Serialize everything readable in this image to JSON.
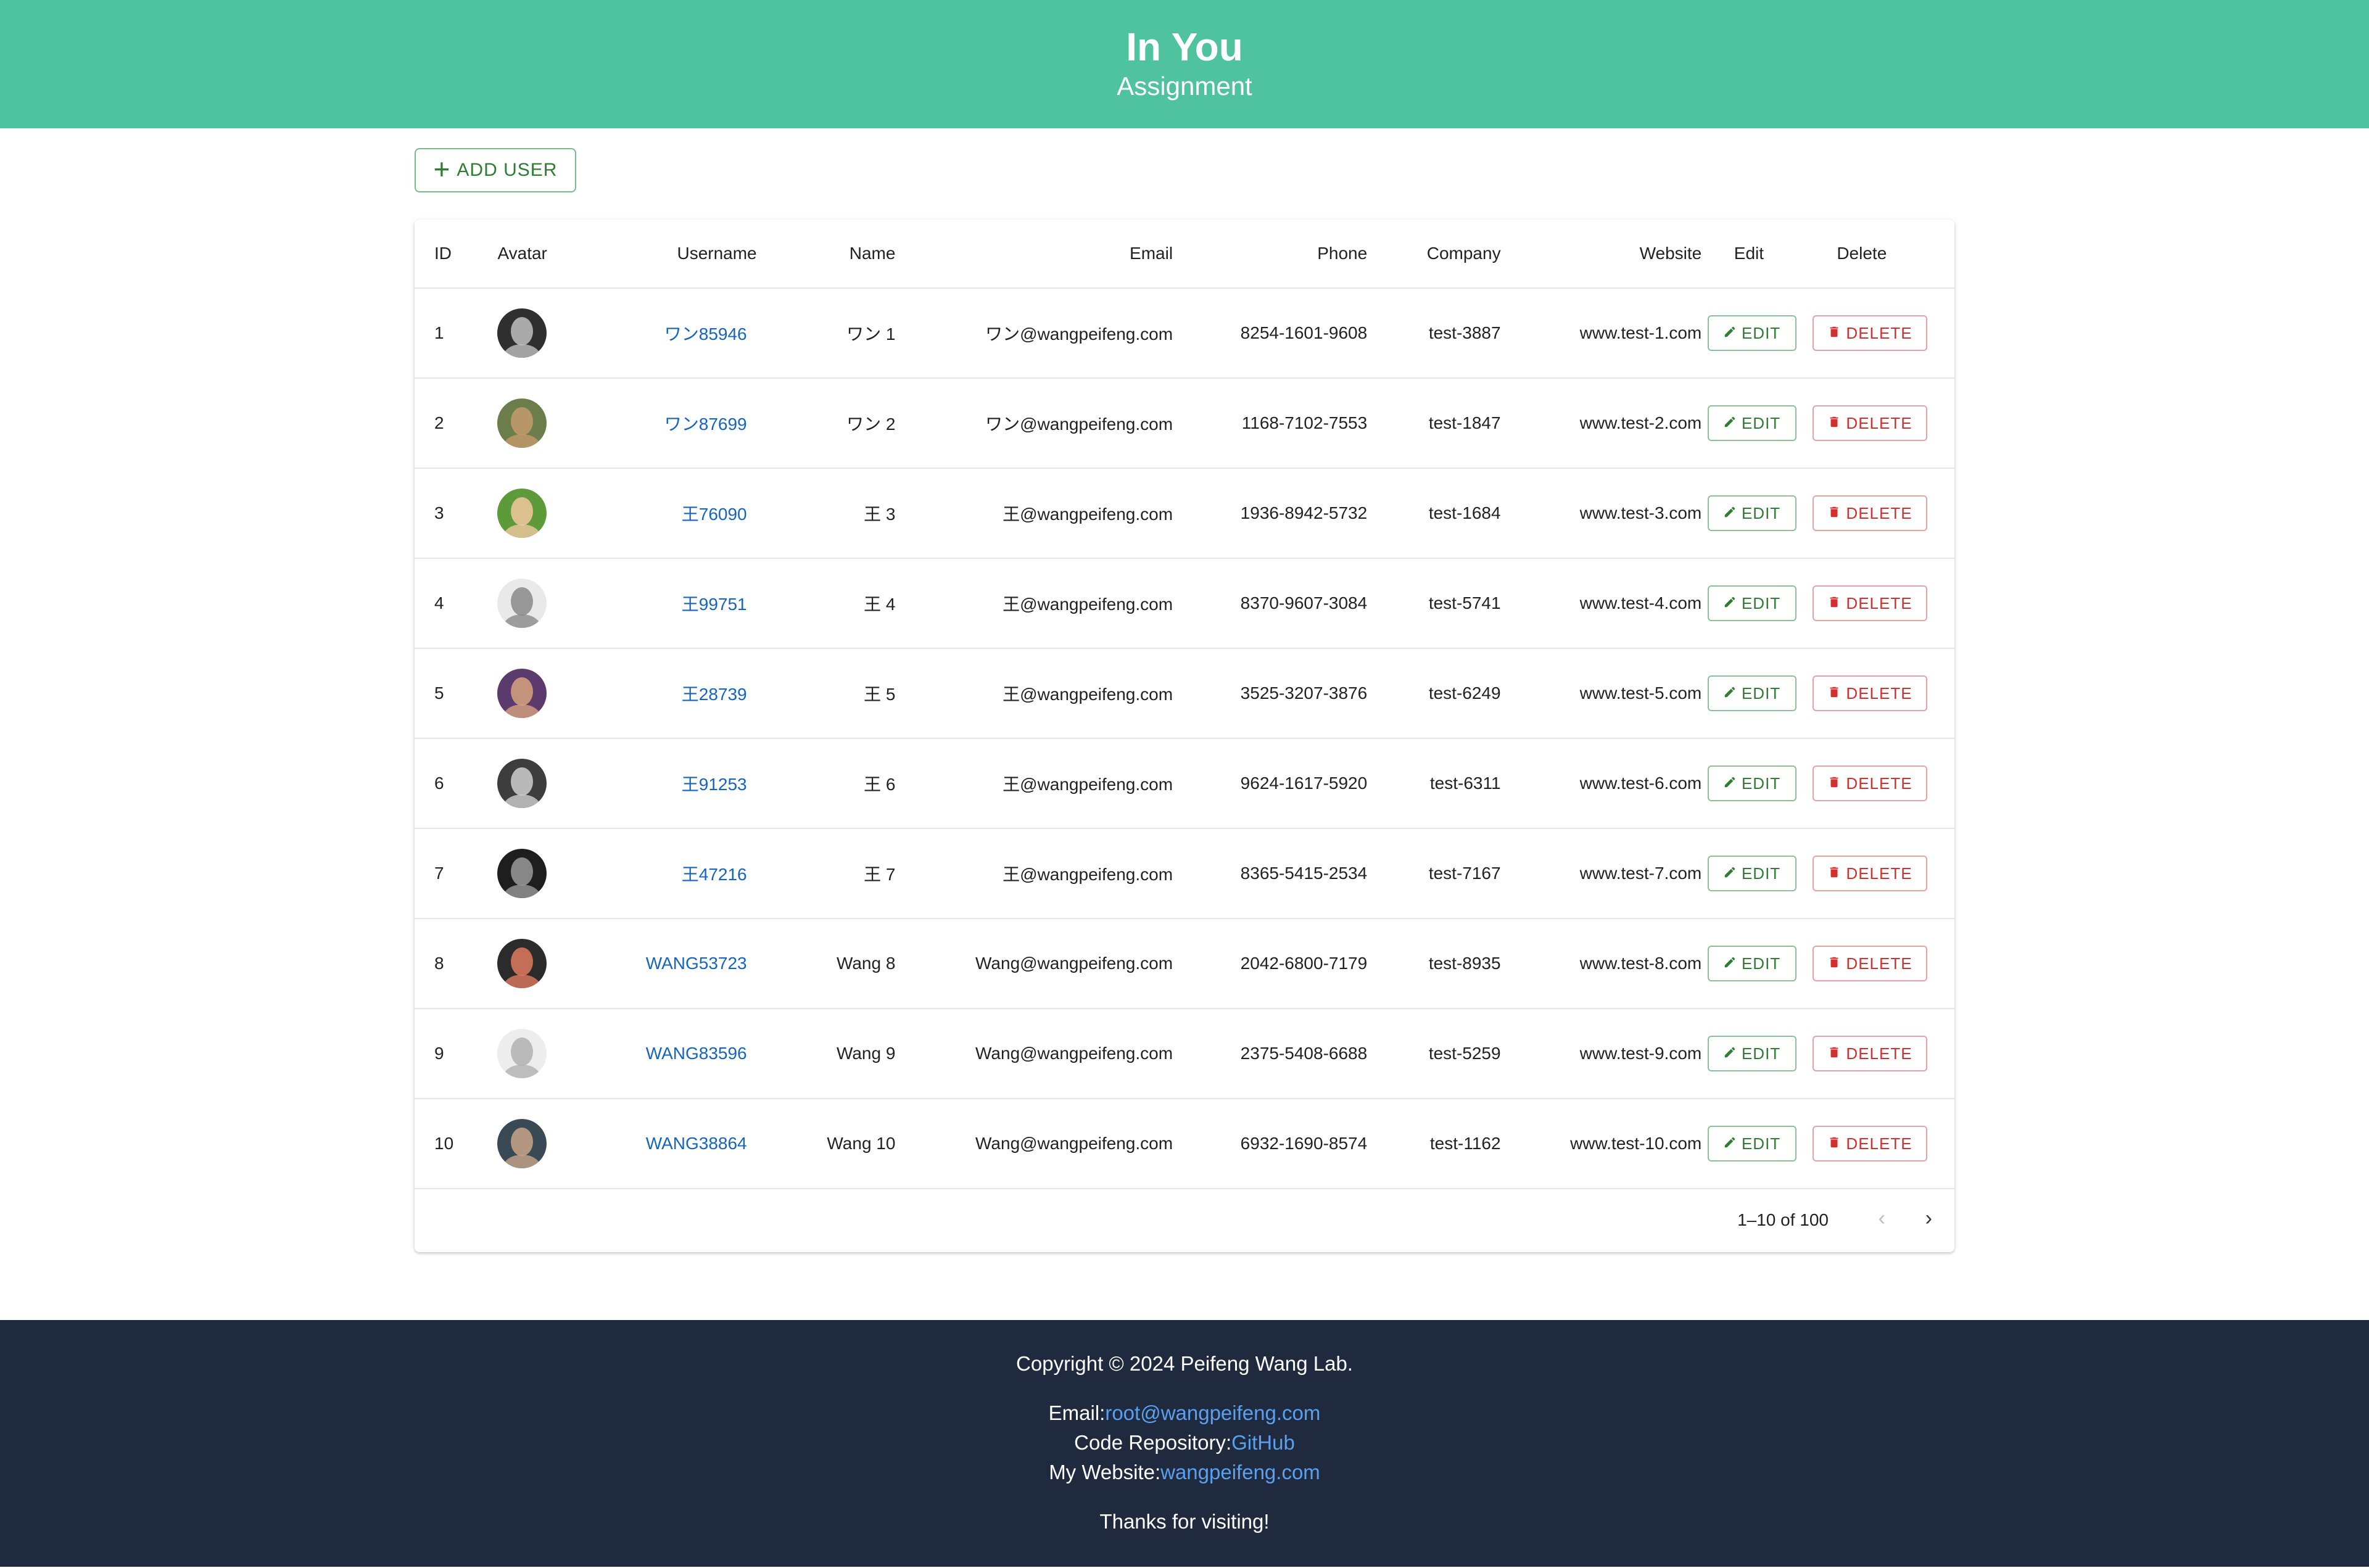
{
  "header": {
    "title": "In You",
    "subtitle": "Assignment"
  },
  "toolbar": {
    "add_user_label": "ADD USER"
  },
  "table": {
    "columns": [
      "ID",
      "Avatar",
      "Username",
      "Name",
      "Email",
      "Phone",
      "Company",
      "Website",
      "Edit",
      "Delete"
    ],
    "edit_label": "EDIT",
    "delete_label": "DELETE",
    "rows": [
      {
        "id": "1",
        "username": "ワン85946",
        "name": "ワン 1",
        "email": "ワン@wangpeifeng.com",
        "phone": "8254-1601-9608",
        "company": "test-3887",
        "website": "www.test-1.com",
        "avatar_colors": [
          "#2f2f2f",
          "#bfbfbf"
        ]
      },
      {
        "id": "2",
        "username": "ワン87699",
        "name": "ワン 2",
        "email": "ワン@wangpeifeng.com",
        "phone": "1168-7102-7553",
        "company": "test-1847",
        "website": "www.test-2.com",
        "avatar_colors": [
          "#6b7d4a",
          "#c49a6c"
        ]
      },
      {
        "id": "3",
        "username": "王76090",
        "name": "王 3",
        "email": "王@wangpeifeng.com",
        "phone": "1936-8942-5732",
        "company": "test-1684",
        "website": "www.test-3.com",
        "avatar_colors": [
          "#5c9a3a",
          "#f2c7a0"
        ]
      },
      {
        "id": "4",
        "username": "王99751",
        "name": "王 4",
        "email": "王@wangpeifeng.com",
        "phone": "8370-9607-3084",
        "company": "test-5741",
        "website": "www.test-4.com",
        "avatar_colors": [
          "#e9e9e9",
          "#8a8a8a"
        ]
      },
      {
        "id": "5",
        "username": "王28739",
        "name": "王 5",
        "email": "王@wangpeifeng.com",
        "phone": "3525-3207-3876",
        "company": "test-6249",
        "website": "www.test-5.com",
        "avatar_colors": [
          "#5b3a6e",
          "#d7a37f"
        ]
      },
      {
        "id": "6",
        "username": "王91253",
        "name": "王 6",
        "email": "王@wangpeifeng.com",
        "phone": "9624-1617-5920",
        "company": "test-6311",
        "website": "www.test-6.com",
        "avatar_colors": [
          "#3d3d3d",
          "#cfcfcf"
        ]
      },
      {
        "id": "7",
        "username": "王47216",
        "name": "王 7",
        "email": "王@wangpeifeng.com",
        "phone": "8365-5415-2534",
        "company": "test-7167",
        "website": "www.test-7.com",
        "avatar_colors": [
          "#1e1e1e",
          "#9a9a9a"
        ]
      },
      {
        "id": "8",
        "username": "WANG53723",
        "name": "Wang 8",
        "email": "Wang@wangpeifeng.com",
        "phone": "2042-6800-7179",
        "company": "test-8935",
        "website": "www.test-8.com",
        "avatar_colors": [
          "#2b2b2b",
          "#e07a5f"
        ]
      },
      {
        "id": "9",
        "username": "WANG83596",
        "name": "Wang 9",
        "email": "Wang@wangpeifeng.com",
        "phone": "2375-5408-6688",
        "company": "test-5259",
        "website": "www.test-9.com",
        "avatar_colors": [
          "#ededed",
          "#b0b0b0"
        ]
      },
      {
        "id": "10",
        "username": "WANG38864",
        "name": "Wang 10",
        "email": "Wang@wangpeifeng.com",
        "phone": "6932-1690-8574",
        "company": "test-1162",
        "website": "www.test-10.com",
        "avatar_colors": [
          "#3a4a55",
          "#c9a58a"
        ]
      }
    ]
  },
  "pagination": {
    "range": "1–10 of 100",
    "prev_icon": "chevron-left-icon",
    "next_icon": "chevron-right-icon"
  },
  "footer": {
    "copyright": "Copyright © 2024 Peifeng Wang Lab.",
    "email_label": "Email:",
    "email_value": "root@wangpeifeng.com",
    "repo_label": "Code Repository:",
    "repo_value": "GitHub",
    "website_label": "My Website:",
    "website_value": "wangpeifeng.com",
    "thanks": "Thanks for visiting!"
  },
  "colors": {
    "header_bg": "#4fc39d",
    "footer_bg": "#1f2a3f",
    "link": "#1565c0",
    "edit": "#2e7d32",
    "delete": "#d32f2f",
    "footer_link": "#5aa0ee"
  }
}
